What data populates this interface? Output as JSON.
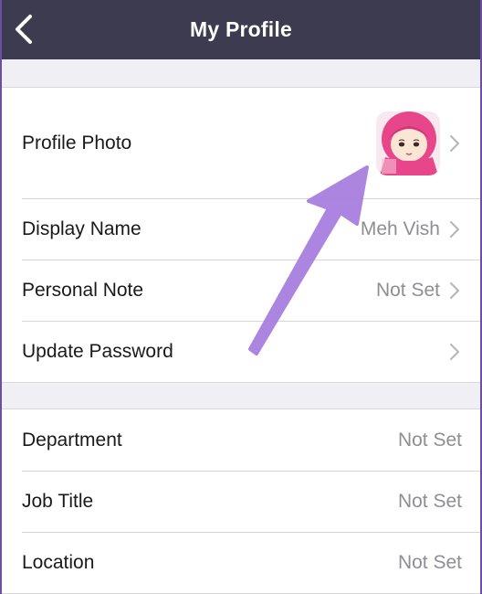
{
  "navbar": {
    "title": "My Profile",
    "back_icon": "chevron-left-icon"
  },
  "profile": {
    "rows": [
      {
        "label": "Profile Photo",
        "value": "",
        "chevron": true
      },
      {
        "label": "Display Name",
        "value": "Meh Vish",
        "chevron": true
      },
      {
        "label": "Personal Note",
        "value": "Not Set",
        "chevron": true
      },
      {
        "label": "Update Password",
        "value": "",
        "chevron": true
      }
    ]
  },
  "work": {
    "rows": [
      {
        "label": "Department",
        "value": "Not Set"
      },
      {
        "label": "Job Title",
        "value": "Not Set"
      },
      {
        "label": "Location",
        "value": "Not Set"
      }
    ]
  },
  "colors": {
    "navbar": "#3d3b4f",
    "background": "#efeff4",
    "annotation_arrow": "#a87fe0"
  }
}
